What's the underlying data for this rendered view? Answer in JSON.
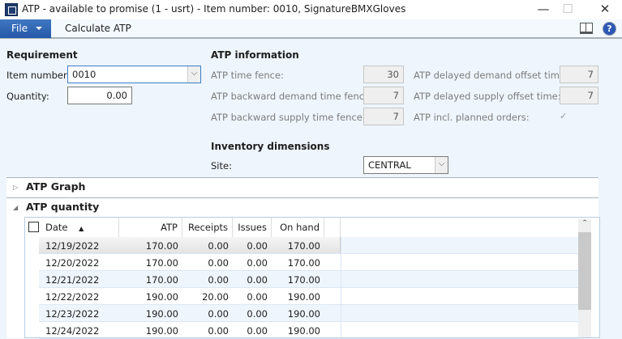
{
  "window": {
    "title": "ATP - available to promise (1 - usrt) - Item number: 0010, SignatureBMXGloves",
    "minimize": "—",
    "maximize": "☐",
    "close": "✕"
  },
  "toolbar": {
    "file": "File",
    "calculate": "Calculate ATP"
  },
  "requirement": {
    "heading": "Requirement",
    "item_label": "Item number:",
    "item_value": "0010",
    "qty_label": "Quantity:",
    "qty_value": "0.00"
  },
  "atp_info": {
    "heading": "ATP information",
    "time_fence_label": "ATP time fence:",
    "time_fence": "30",
    "backward_demand_label": "ATP backward demand time fence:",
    "backward_demand": "7",
    "backward_supply_label": "ATP backward supply time fence:",
    "backward_supply": "7",
    "delayed_demand_label": "ATP delayed demand offset time:",
    "delayed_demand": "7",
    "delayed_supply_label": "ATP delayed supply offset time:",
    "delayed_supply": "7",
    "planned_orders_label": "ATP incl. planned orders:",
    "planned_orders": true
  },
  "inventory": {
    "heading": "Inventory dimensions",
    "site_label": "Site:",
    "site_value": "CENTRAL"
  },
  "sections": {
    "graph": "ATP Graph",
    "quantity": "ATP quantity"
  },
  "grid": {
    "columns": [
      "Date",
      "ATP",
      "Receipts",
      "Issues",
      "On hand"
    ],
    "rows": [
      [
        "12/19/2022",
        "170.00",
        "0.00",
        "0.00",
        "170.00"
      ],
      [
        "12/20/2022",
        "170.00",
        "0.00",
        "0.00",
        "170.00"
      ],
      [
        "12/21/2022",
        "170.00",
        "0.00",
        "0.00",
        "170.00"
      ],
      [
        "12/22/2022",
        "190.00",
        "20.00",
        "0.00",
        "190.00"
      ],
      [
        "12/23/2022",
        "190.00",
        "0.00",
        "0.00",
        "190.00"
      ],
      [
        "12/24/2022",
        "190.00",
        "0.00",
        "0.00",
        "190.00"
      ]
    ]
  }
}
